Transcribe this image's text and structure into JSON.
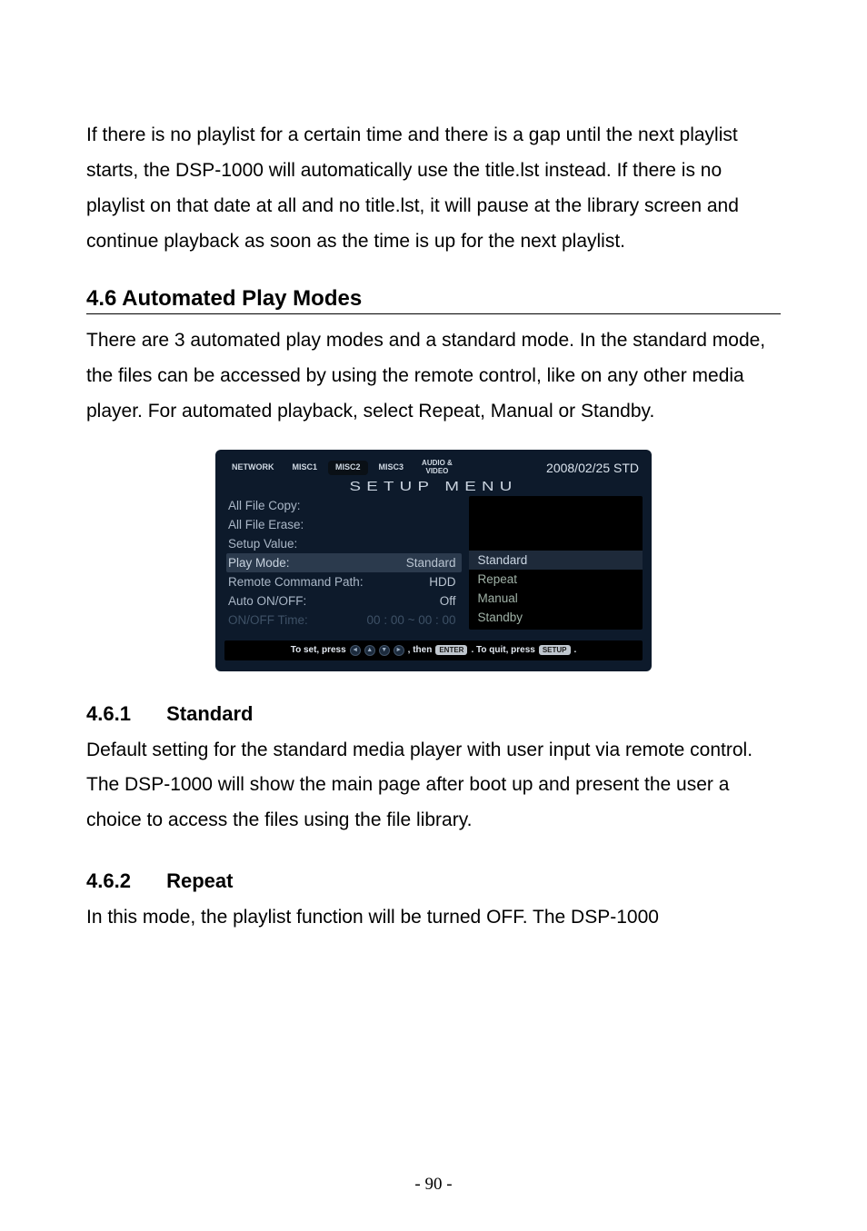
{
  "intro_para": "If there is no playlist for a certain time and there is a gap until the next playlist starts, the DSP-1000 will automatically use the title.lst instead. If there is no playlist on that date at all and no title.lst, it will pause at the library screen and continue playback as soon as the time is up for the next playlist.",
  "section": {
    "heading": "4.6 Automated Play Modes",
    "para": "There are 3 automated play modes and a standard mode. In the standard mode, the files can be accessed by using the remote control, like on any other media player. For automated playback, select Repeat, Manual or Standby."
  },
  "screenshot": {
    "tabs": [
      "NETWORK",
      "MISC1",
      "MISC2",
      "MISC3",
      "AUDIO &\nVIDEO"
    ],
    "date": "2008/02/25 STD",
    "title": "SETUP MENU",
    "rows": [
      {
        "label": "All File Copy:",
        "value": ""
      },
      {
        "label": "All File Erase:",
        "value": ""
      },
      {
        "label": "Setup Value:",
        "value": ""
      },
      {
        "label": "Play Mode:",
        "value": "Standard"
      },
      {
        "label": "Remote Command Path:",
        "value": "HDD"
      },
      {
        "label": "Auto ON/OFF:",
        "value": "Off"
      },
      {
        "label": "ON/OFF Time:",
        "value": "00 : 00 ~ 00 : 00"
      }
    ],
    "options": [
      "Standard",
      "Repeat",
      "Manual",
      "Standby"
    ],
    "footer_pre": "To set, press",
    "footer_mid": ", then",
    "footer_key1": "ENTER",
    "footer_post": ". To quit, press",
    "footer_key2": "SETUP",
    "footer_end": "."
  },
  "sub1": {
    "num": "4.6.1",
    "title": "Standard",
    "para": "Default setting for the standard media player with user input via remote control. The DSP-1000 will show the main page after boot up and present the user a choice to access the files using the file library."
  },
  "sub2": {
    "num": "4.6.2",
    "title": "Repeat",
    "para": "In this mode, the playlist function will be turned OFF. The DSP-1000"
  },
  "page_number": "- 90 -"
}
